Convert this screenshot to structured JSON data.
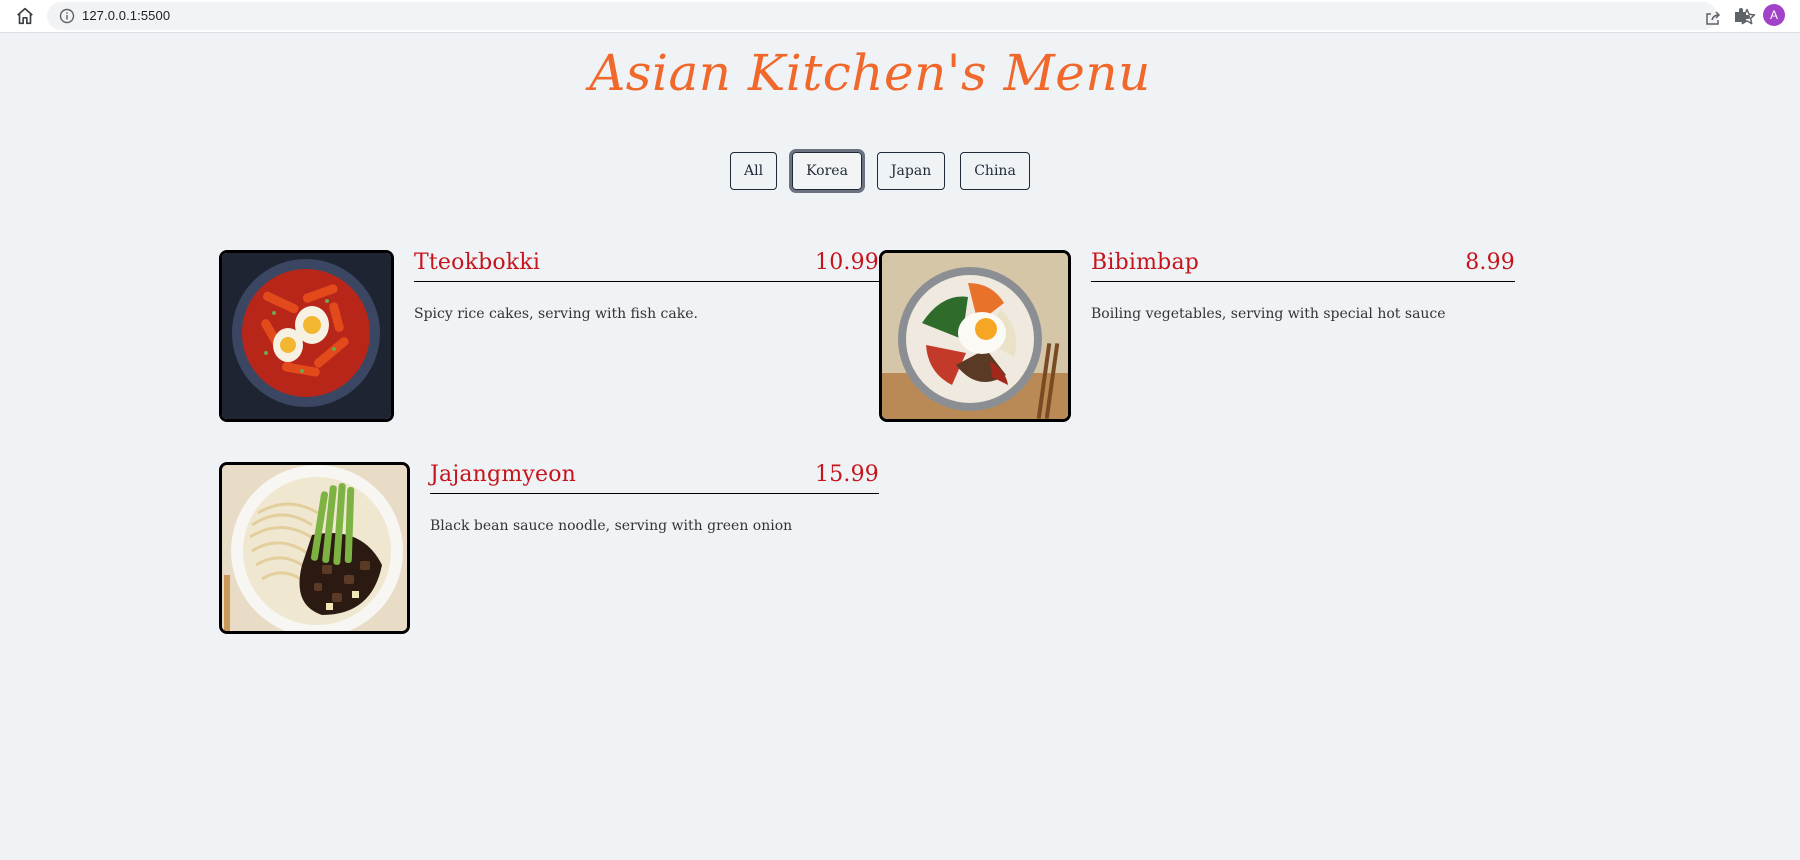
{
  "browser": {
    "url": "127.0.0.1:5500",
    "avatar_letter": "A",
    "icons": [
      "home-icon",
      "info-icon",
      "share-icon",
      "star-icon",
      "extensions-icon"
    ]
  },
  "page": {
    "title": "Asian Kitchen's Menu",
    "title_color": "#f0682c",
    "accent_color": "#c5141b"
  },
  "filters": [
    {
      "label": "All",
      "active": false
    },
    {
      "label": "Korea",
      "active": true
    },
    {
      "label": "Japan",
      "active": false
    },
    {
      "label": "China",
      "active": false
    }
  ],
  "menu": [
    {
      "name": "Tteokbokki",
      "price": "10.99",
      "description": "Spicy rice cakes, serving with fish cake."
    },
    {
      "name": "Bibimbap",
      "price": "8.99",
      "description": "Boiling vegetables, serving with special hot sauce"
    },
    {
      "name": "Jajangmyeon",
      "price": "15.99",
      "description": "Black bean sauce noodle, serving with green onion"
    }
  ]
}
